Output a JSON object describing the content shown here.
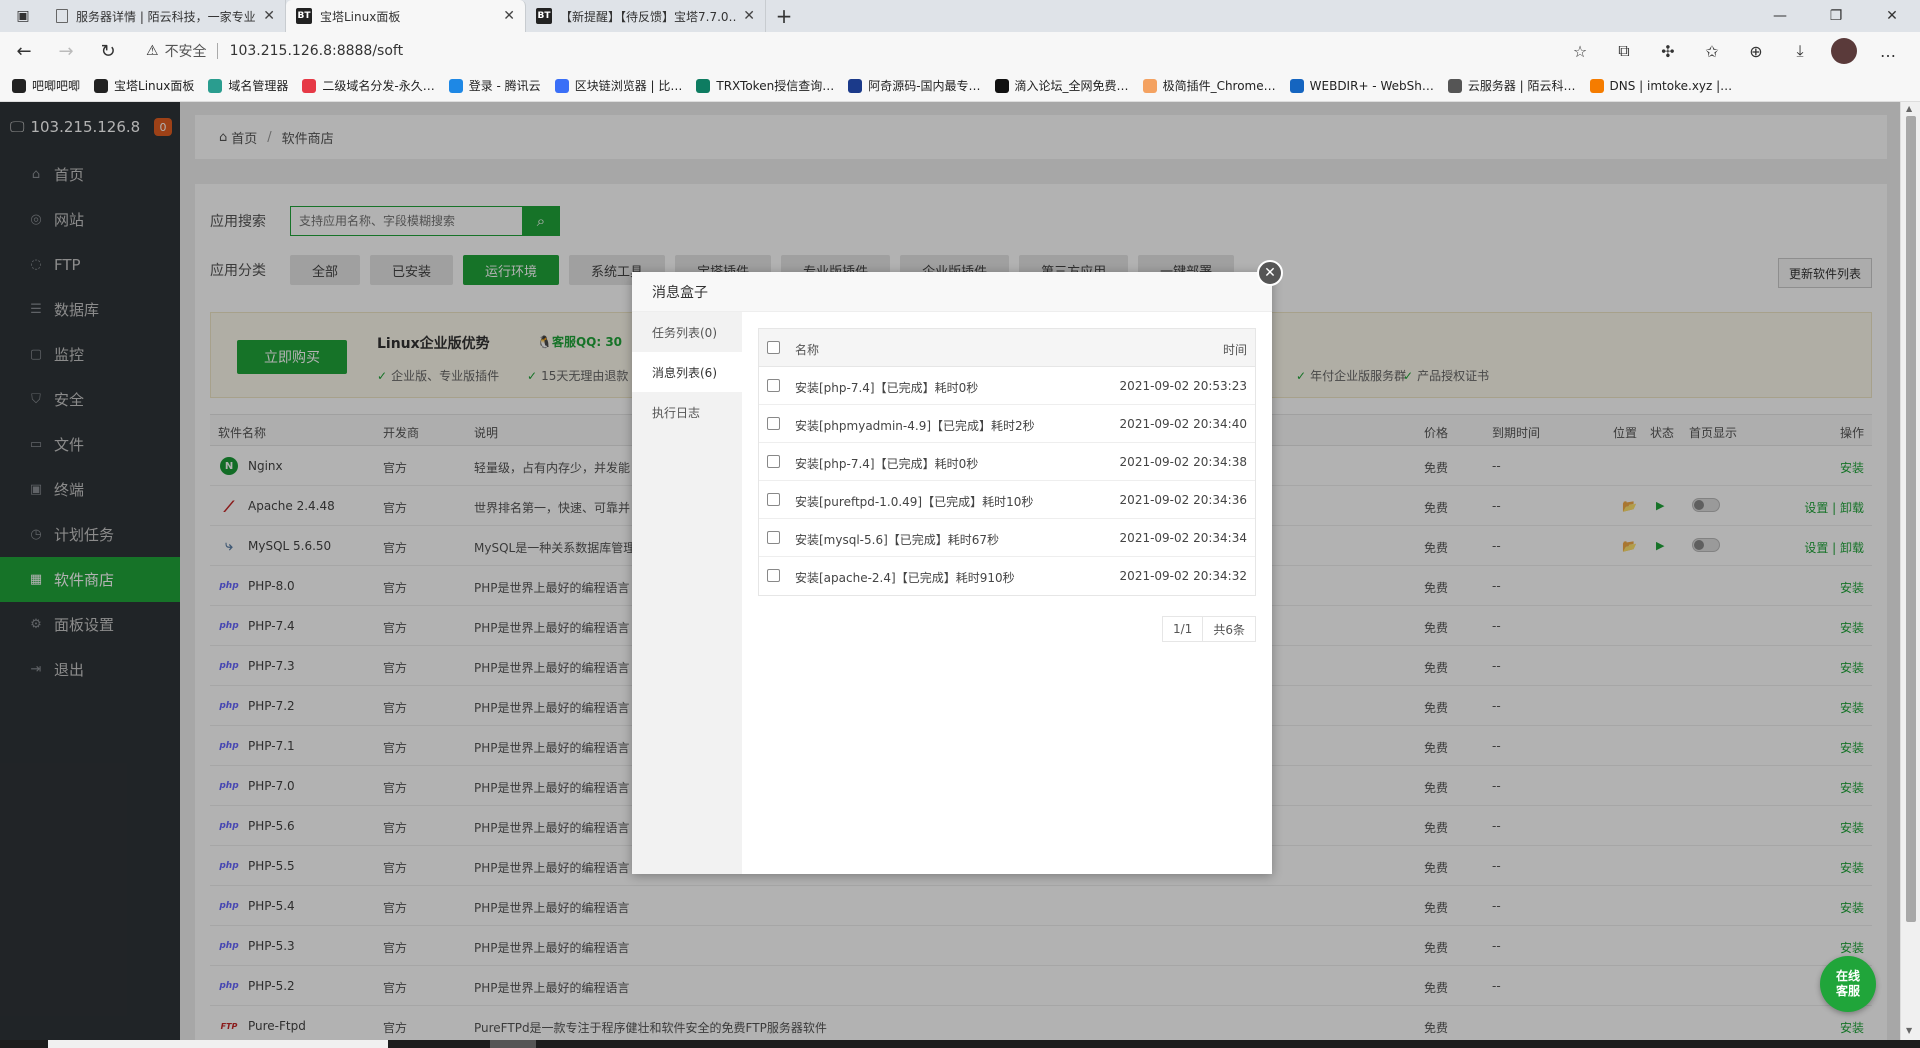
{
  "browser": {
    "tabs": [
      {
        "title": "服务器详情 | 陌云科技，一家专业…"
      },
      {
        "title": "宝塔Linux面板"
      },
      {
        "title": "【新提醒】【待反馈】宝塔7.7.0…"
      }
    ],
    "address": {
      "insecure": "不安全",
      "url": "103.215.126.8:8888/soft"
    },
    "bookmarks": [
      {
        "label": "吧唧吧唧",
        "color": "#222"
      },
      {
        "label": "宝塔Linux面板",
        "color": "#222"
      },
      {
        "label": "域名管理器",
        "color": "#2a9d8f"
      },
      {
        "label": "二级域名分发-永久…",
        "color": "#e63946"
      },
      {
        "label": "登录 - 腾讯云",
        "color": "#1e88e5"
      },
      {
        "label": "区块链浏览器 | 比…",
        "color": "#3a6ff7"
      },
      {
        "label": "TRXToken授信查询…",
        "color": "#0e7c61"
      },
      {
        "label": "阿奇源码-国内最专…",
        "color": "#1b3a8a"
      },
      {
        "label": "滴入论坛_全网免费…",
        "color": "#111"
      },
      {
        "label": "极简插件_Chrome…",
        "color": "#f4a261"
      },
      {
        "label": "WEBDIR+ - WebSh…",
        "color": "#1565c0"
      },
      {
        "label": "云服务器 | 陌云科…",
        "color": "#555"
      },
      {
        "label": "DNS | imtoke.xyz |…",
        "color": "#f57c00"
      }
    ]
  },
  "sidebar": {
    "ip": "103.215.126.8",
    "badge": "0",
    "items": [
      {
        "label": "首页",
        "icon": "home-icon",
        "glyph": "⌂"
      },
      {
        "label": "网站",
        "icon": "globe-icon",
        "glyph": "◎"
      },
      {
        "label": "FTP",
        "icon": "ftp-icon",
        "glyph": "◌"
      },
      {
        "label": "数据库",
        "icon": "database-icon",
        "glyph": "☰"
      },
      {
        "label": "监控",
        "icon": "monitor-icon",
        "glyph": "▢"
      },
      {
        "label": "安全",
        "icon": "shield-icon",
        "glyph": "⛉"
      },
      {
        "label": "文件",
        "icon": "folder-icon",
        "glyph": "▭"
      },
      {
        "label": "终端",
        "icon": "terminal-icon",
        "glyph": "▣"
      },
      {
        "label": "计划任务",
        "icon": "clock-icon",
        "glyph": "◷"
      },
      {
        "label": "软件商店",
        "icon": "apps-icon",
        "glyph": "▦"
      },
      {
        "label": "面板设置",
        "icon": "settings-icon",
        "glyph": "⚙"
      },
      {
        "label": "退出",
        "icon": "logout-icon",
        "glyph": "⇥"
      }
    ]
  },
  "breadcrumb": {
    "home": "首页",
    "current": "软件商店"
  },
  "search": {
    "label": "应用搜索",
    "placeholder": "支持应用名称、字段模糊搜索"
  },
  "category": {
    "label": "应用分类",
    "items": [
      "全部",
      "已安装",
      "运行环境",
      "系统工具",
      "宝塔插件",
      "专业版插件",
      "企业版插件",
      "第三方应用",
      "一键部署"
    ],
    "update": "更新软件列表"
  },
  "promo": {
    "buy": "立即购买",
    "title": "Linux企业版优势",
    "qq": "客服QQ: 30",
    "features": [
      "企业版、专业版插件",
      "15天无理由退款",
      "年付企业版服务群",
      "产品授权证书"
    ]
  },
  "table": {
    "headers": [
      "软件名称",
      "开发商",
      "说明",
      "价格",
      "到期时间",
      "位置",
      "状态",
      "首页显示",
      "操作"
    ],
    "rows": [
      {
        "name": "Nginx",
        "dev": "官方",
        "desc": "轻量级，占有内存少，并发能",
        "price": "免费",
        "exp": "--",
        "op": "安装",
        "icon": "N",
        "kind": "ng"
      },
      {
        "name": "Apache 2.4.48",
        "dev": "官方",
        "desc": "世界排名第一，快速、可靠并",
        "price": "免费",
        "exp": "--",
        "op": "设置 | 卸载",
        "icon": "⁄",
        "kind": "ap",
        "installed": true
      },
      {
        "name": "MySQL 5.6.50",
        "dev": "官方",
        "desc": "MySQL是一种关系数据库管理",
        "price": "免费",
        "exp": "--",
        "op": "设置 | 卸载",
        "icon": "⤷",
        "kind": "my",
        "installed": true
      },
      {
        "name": "PHP-8.0",
        "dev": "官方",
        "desc": "PHP是世界上最好的编程语言",
        "price": "免费",
        "exp": "--",
        "op": "安装",
        "icon": "php",
        "kind": "php"
      },
      {
        "name": "PHP-7.4",
        "dev": "官方",
        "desc": "PHP是世界上最好的编程语言",
        "price": "免费",
        "exp": "--",
        "op": "安装",
        "icon": "php",
        "kind": "php"
      },
      {
        "name": "PHP-7.3",
        "dev": "官方",
        "desc": "PHP是世界上最好的编程语言",
        "price": "免费",
        "exp": "--",
        "op": "安装",
        "icon": "php",
        "kind": "php"
      },
      {
        "name": "PHP-7.2",
        "dev": "官方",
        "desc": "PHP是世界上最好的编程语言",
        "price": "免费",
        "exp": "--",
        "op": "安装",
        "icon": "php",
        "kind": "php"
      },
      {
        "name": "PHP-7.1",
        "dev": "官方",
        "desc": "PHP是世界上最好的编程语言",
        "price": "免费",
        "exp": "--",
        "op": "安装",
        "icon": "php",
        "kind": "php"
      },
      {
        "name": "PHP-7.0",
        "dev": "官方",
        "desc": "PHP是世界上最好的编程语言",
        "price": "免费",
        "exp": "--",
        "op": "安装",
        "icon": "php",
        "kind": "php"
      },
      {
        "name": "PHP-5.6",
        "dev": "官方",
        "desc": "PHP是世界上最好的编程语言",
        "price": "免费",
        "exp": "--",
        "op": "安装",
        "icon": "php",
        "kind": "php"
      },
      {
        "name": "PHP-5.5",
        "dev": "官方",
        "desc": "PHP是世界上最好的编程语言",
        "price": "免费",
        "exp": "--",
        "op": "安装",
        "icon": "php",
        "kind": "php"
      },
      {
        "name": "PHP-5.4",
        "dev": "官方",
        "desc": "PHP是世界上最好的编程语言",
        "price": "免费",
        "exp": "--",
        "op": "安装",
        "icon": "php",
        "kind": "php"
      },
      {
        "name": "PHP-5.3",
        "dev": "官方",
        "desc": "PHP是世界上最好的编程语言",
        "price": "免费",
        "exp": "--",
        "op": "安装",
        "icon": "php",
        "kind": "php"
      },
      {
        "name": "PHP-5.2",
        "dev": "官方",
        "desc": "PHP是世界上最好的编程语言",
        "price": "免费",
        "exp": "--",
        "op": "安装",
        "icon": "php",
        "kind": "php"
      },
      {
        "name": "Pure-Ftpd",
        "dev": "官方",
        "desc": "PureFTPd是一款专注于程序健壮和软件安全的免费FTP服务器软件",
        "price": "免费",
        "exp": "",
        "op": "安装",
        "icon": "FTP",
        "kind": "ftp"
      }
    ]
  },
  "modal": {
    "title": "消息盒子",
    "tabs": [
      "任务列表(0)",
      "消息列表(6)",
      "执行日志"
    ],
    "active_tab": 1,
    "col_name": "名称",
    "col_time": "时间",
    "messages": [
      {
        "name": "安装[php-7.4]【已完成】耗时0秒",
        "time": "2021-09-02 20:53:23"
      },
      {
        "name": "安装[phpmyadmin-4.9]【已完成】耗时2秒",
        "time": "2021-09-02 20:34:40"
      },
      {
        "name": "安装[php-7.4]【已完成】耗时0秒",
        "time": "2021-09-02 20:34:38"
      },
      {
        "name": "安装[pureftpd-1.0.49]【已完成】耗时10秒",
        "time": "2021-09-02 20:34:36"
      },
      {
        "name": "安装[mysql-5.6]【已完成】耗时67秒",
        "time": "2021-09-02 20:34:34"
      },
      {
        "name": "安装[apache-2.4]【已完成】耗时910秒",
        "time": "2021-09-02 20:34:32"
      }
    ],
    "page": "1/1",
    "total": "共6条"
  },
  "help": {
    "line1": "在线",
    "line2": "客服"
  },
  "colors": {
    "accent": "#20a53a",
    "sidebar": "#2f3438",
    "badge": "#e15e22"
  }
}
